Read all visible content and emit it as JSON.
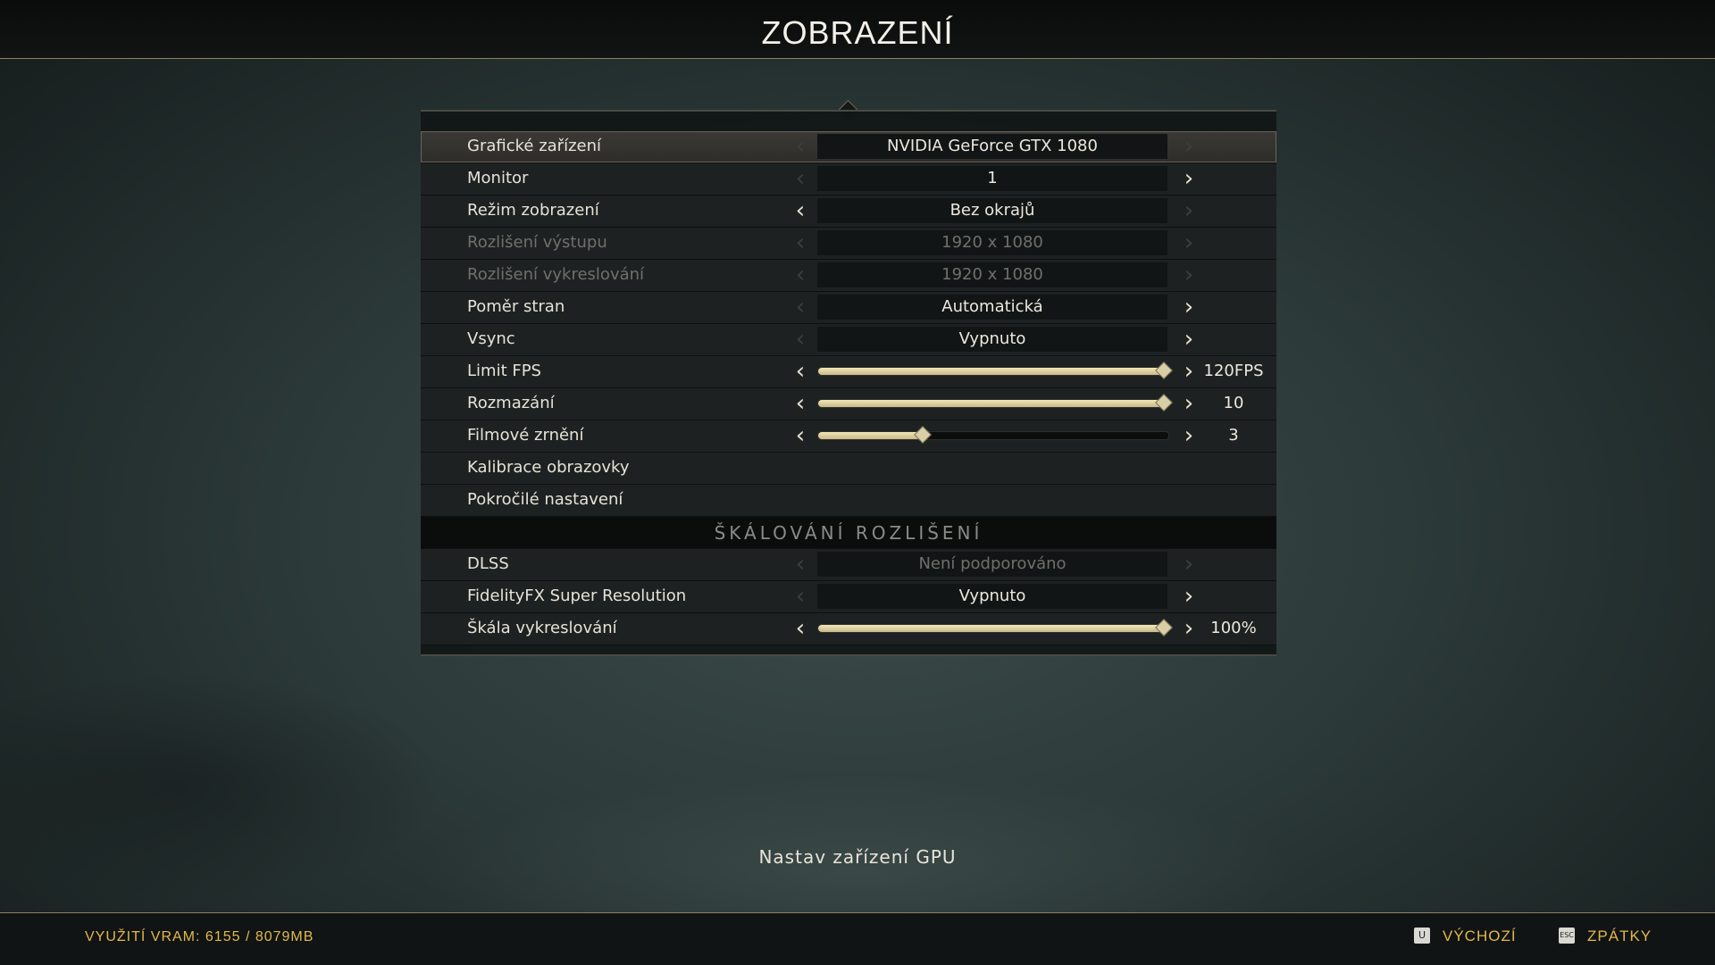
{
  "header": {
    "title": "ZOBRAZENÍ"
  },
  "settings": [
    {
      "label": "Grafické zařízení",
      "type": "select",
      "value": "NVIDIA GeForce GTX 1080",
      "selected": true,
      "disabled": false,
      "left_enabled": false,
      "right_enabled": false
    },
    {
      "label": "Monitor",
      "type": "select",
      "value": "1",
      "selected": false,
      "disabled": false,
      "left_enabled": false,
      "right_enabled": true
    },
    {
      "label": "Režim zobrazení",
      "type": "select",
      "value": "Bez okrajů",
      "selected": false,
      "disabled": false,
      "left_enabled": true,
      "right_enabled": false
    },
    {
      "label": "Rozlišení výstupu",
      "type": "select",
      "value": "1920 x 1080",
      "selected": false,
      "disabled": true,
      "left_enabled": false,
      "right_enabled": false
    },
    {
      "label": "Rozlišení vykreslování",
      "type": "select",
      "value": "1920 x 1080",
      "selected": false,
      "disabled": true,
      "left_enabled": false,
      "right_enabled": false
    },
    {
      "label": "Poměr stran",
      "type": "select",
      "value": "Automatická",
      "selected": false,
      "disabled": false,
      "left_enabled": false,
      "right_enabled": true
    },
    {
      "label": "Vsync",
      "type": "select",
      "value": "Vypnuto",
      "selected": false,
      "disabled": false,
      "left_enabled": false,
      "right_enabled": true
    },
    {
      "label": "Limit FPS",
      "type": "slider",
      "level": 1.0,
      "value_text": "120FPS"
    },
    {
      "label": "Rozmazání",
      "type": "slider",
      "level": 1.0,
      "value_text": "10"
    },
    {
      "label": "Filmové zrnění",
      "type": "slider",
      "level": 0.3,
      "value_text": "3"
    },
    {
      "label": "Kalibrace obrazovky",
      "type": "link"
    },
    {
      "label": "Pokročilé nastavení",
      "type": "link"
    }
  ],
  "section": {
    "title": "ŠKÁLOVÁNÍ ROZLIŠENÍ"
  },
  "scaling_settings": [
    {
      "label": "DLSS",
      "type": "select",
      "value": "Není podporováno",
      "selected": false,
      "disabled": false,
      "value_disabled": true,
      "left_enabled": false,
      "right_enabled": false
    },
    {
      "label": "FidelityFX Super Resolution",
      "type": "select",
      "value": "Vypnuto",
      "selected": false,
      "disabled": false,
      "left_enabled": false,
      "right_enabled": true
    },
    {
      "label": "Škála vykreslování",
      "type": "slider",
      "level": 1.0,
      "value_text": "100%"
    }
  ],
  "description": "Nastav zařízení GPU",
  "footer": {
    "vram": "VYUŽITÍ VRAM: 6155 / 8079MB",
    "default_key": "U",
    "default_label": "VÝCHOZÍ",
    "back_key": "ESC",
    "back_label": "ZPÁTKY"
  },
  "colors": {
    "accent": "#e2b84a",
    "slider_fill": "#e9deb0",
    "divider": "#8a8266"
  }
}
